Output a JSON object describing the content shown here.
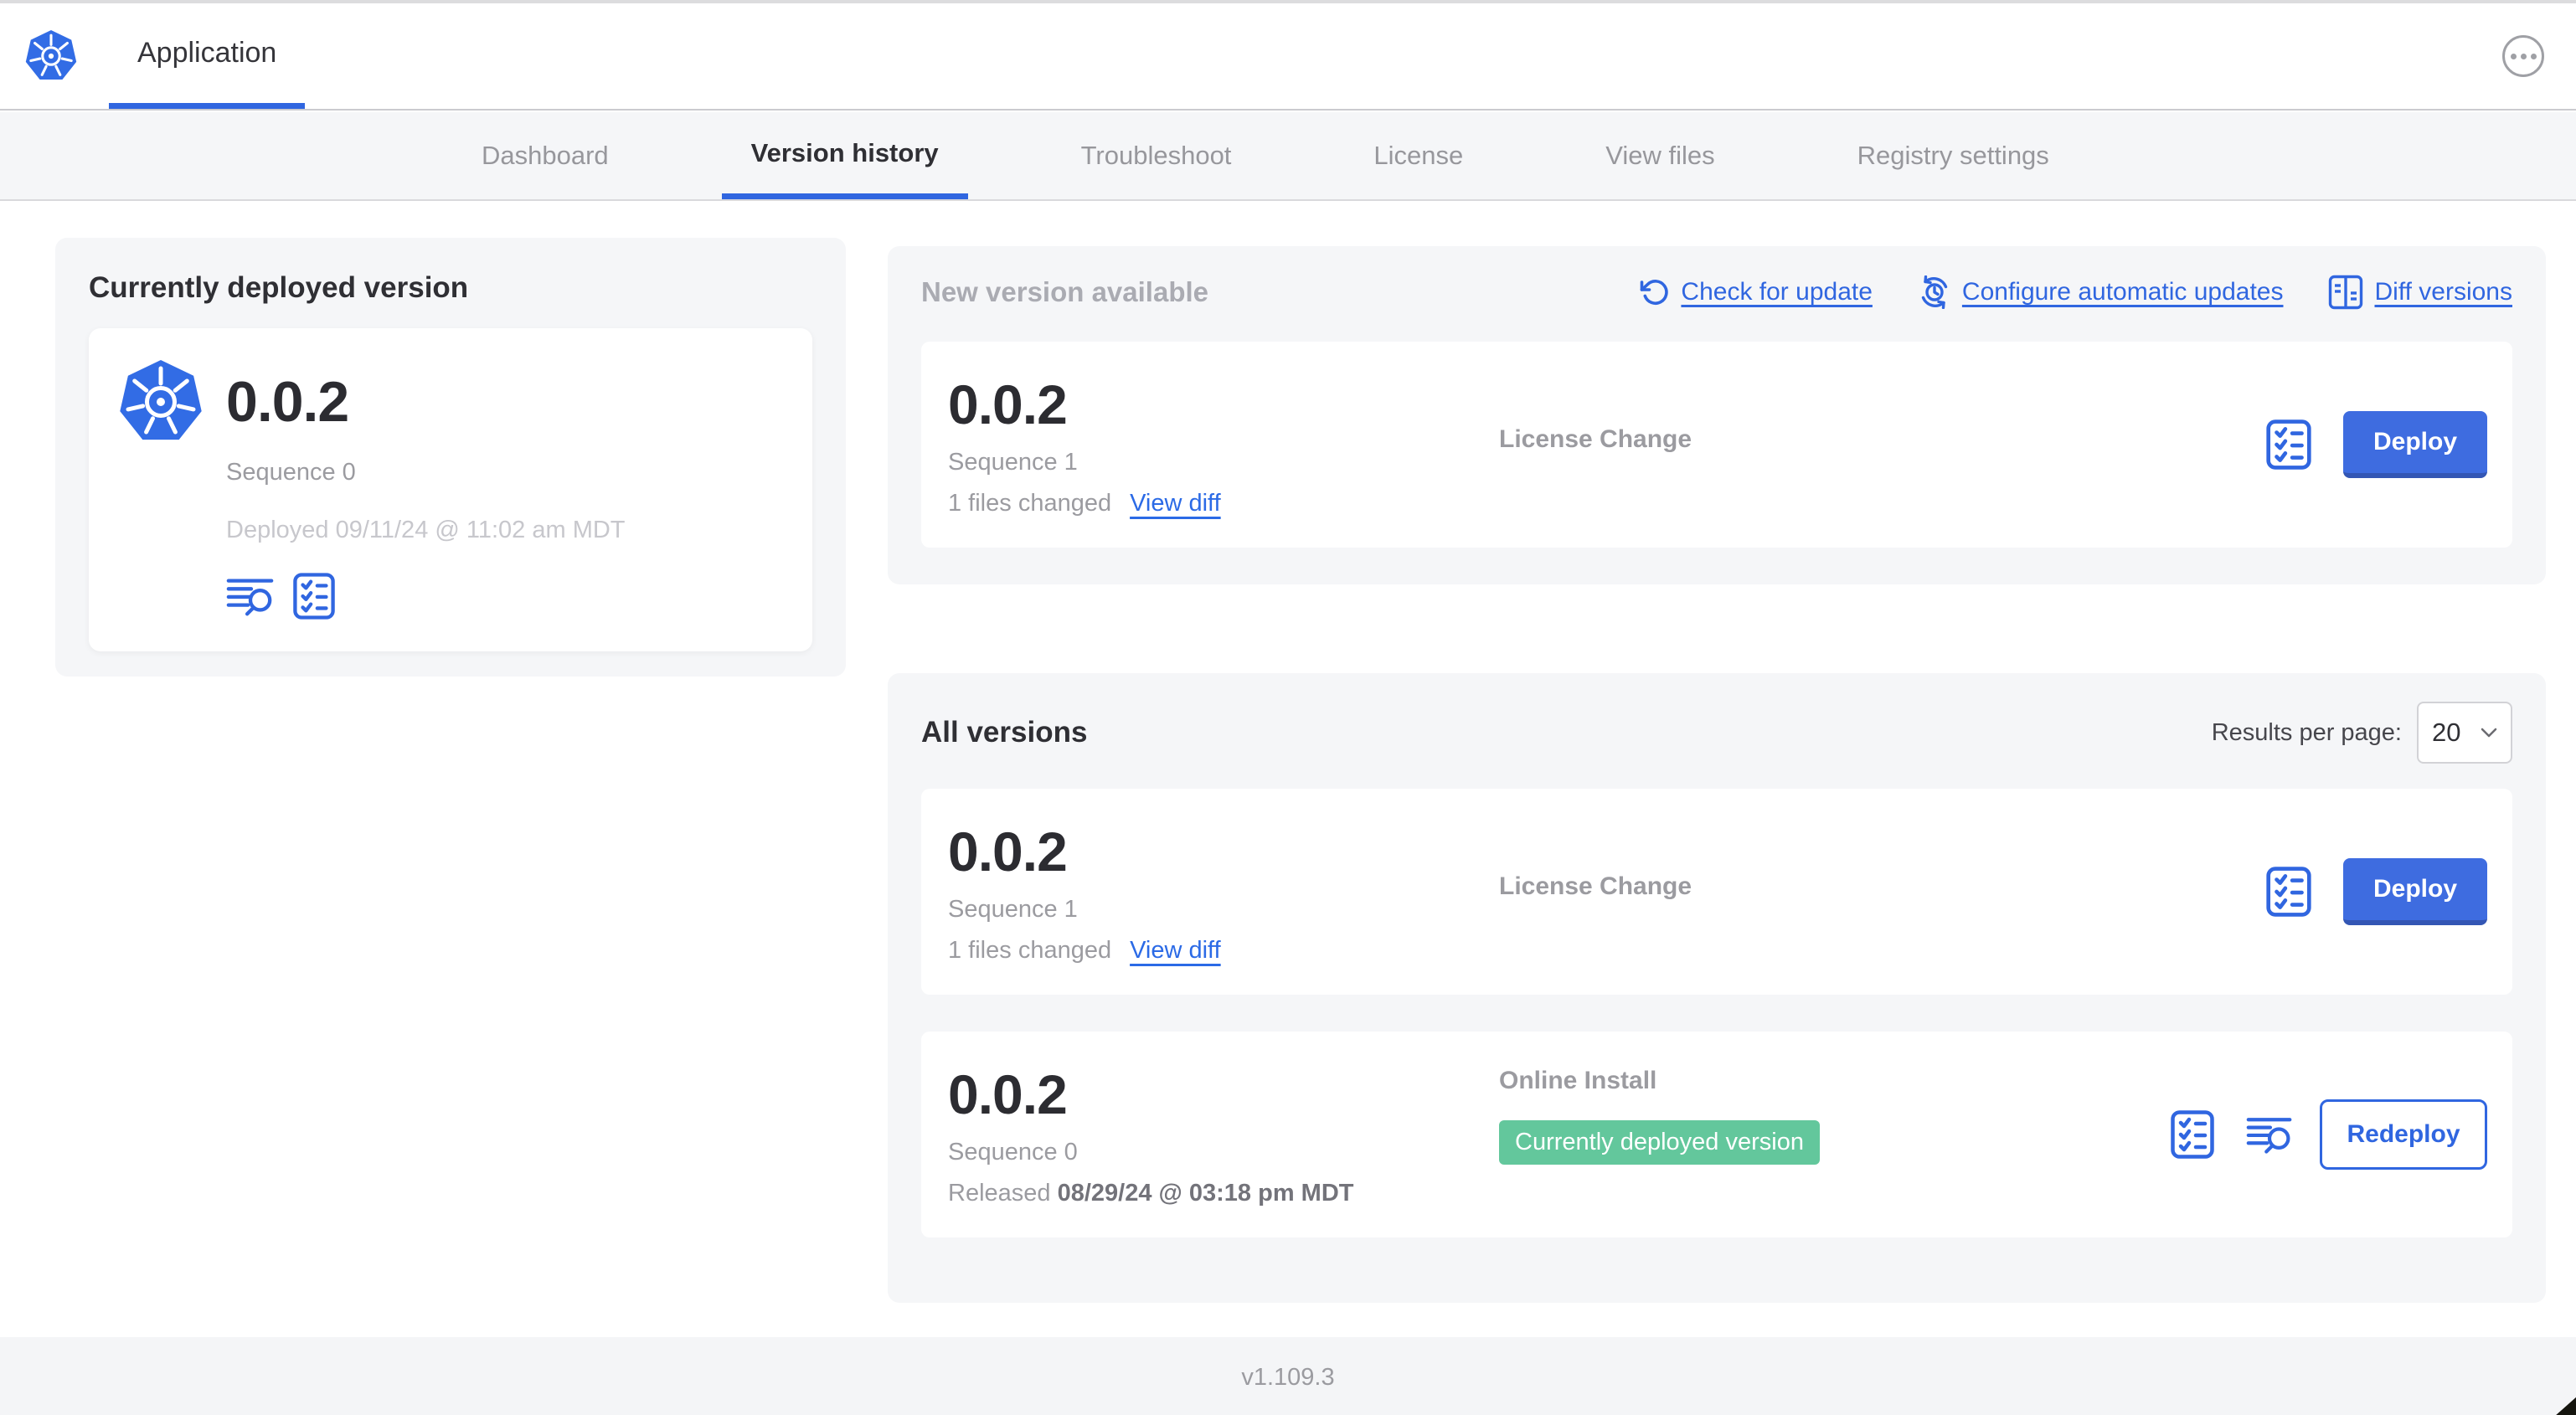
{
  "colors": {
    "accent_blue": "#3066e0",
    "k8s_blue": "#326ce5",
    "badge_green": "#63c79c",
    "panel_gray": "#f5f6f8",
    "text_dark": "#2f2f34",
    "text_gray": "#9b9ba0",
    "text_light_gray": "#c7c7cc"
  },
  "header": {
    "logo_icon": "kubernetes-logo",
    "app_tab_label": "Application",
    "menu_icon": "ellipsis-menu-icon"
  },
  "nav": {
    "tabs": [
      {
        "label": "Dashboard",
        "active": false
      },
      {
        "label": "Version history",
        "active": true
      },
      {
        "label": "Troubleshoot",
        "active": false
      },
      {
        "label": "License",
        "active": false
      },
      {
        "label": "View files",
        "active": false
      },
      {
        "label": "Registry settings",
        "active": false
      }
    ]
  },
  "current_version": {
    "title": "Currently deployed version",
    "version": "0.0.2",
    "sequence": "Sequence 0",
    "deployed": "Deployed 09/11/24 @ 11:02 am MDT",
    "icons": [
      "view-logs-icon",
      "preflight-checklist-icon"
    ]
  },
  "new_version": {
    "title": "New version available",
    "actions": [
      {
        "label": "Check for update",
        "icon": "refresh-icon"
      },
      {
        "label": "Configure automatic updates",
        "icon": "auto-update-icon"
      },
      {
        "label": "Diff versions",
        "icon": "diff-icon"
      }
    ],
    "card": {
      "version": "0.0.2",
      "sequence": "Sequence 1",
      "files_changed": "1 files changed",
      "view_diff_label": "View diff",
      "change_type": "License Change",
      "deploy_label": "Deploy"
    }
  },
  "all_versions": {
    "title": "All versions",
    "results_per_page_label": "Results per page:",
    "results_per_page_value": "20",
    "rows": [
      {
        "version": "0.0.2",
        "sequence": "Sequence 1",
        "files_changed": "1 files changed",
        "view_diff_label": "View diff",
        "change_type": "License Change",
        "action_label": "Deploy"
      },
      {
        "version": "0.0.2",
        "sequence": "Sequence 0",
        "released_label": "Released",
        "released_date": "08/29/24 @ 03:18 pm MDT",
        "install_type": "Online Install",
        "badge": "Currently deployed version",
        "action_label": "Redeploy"
      }
    ]
  },
  "footer": {
    "app_version": "v1.109.3"
  }
}
